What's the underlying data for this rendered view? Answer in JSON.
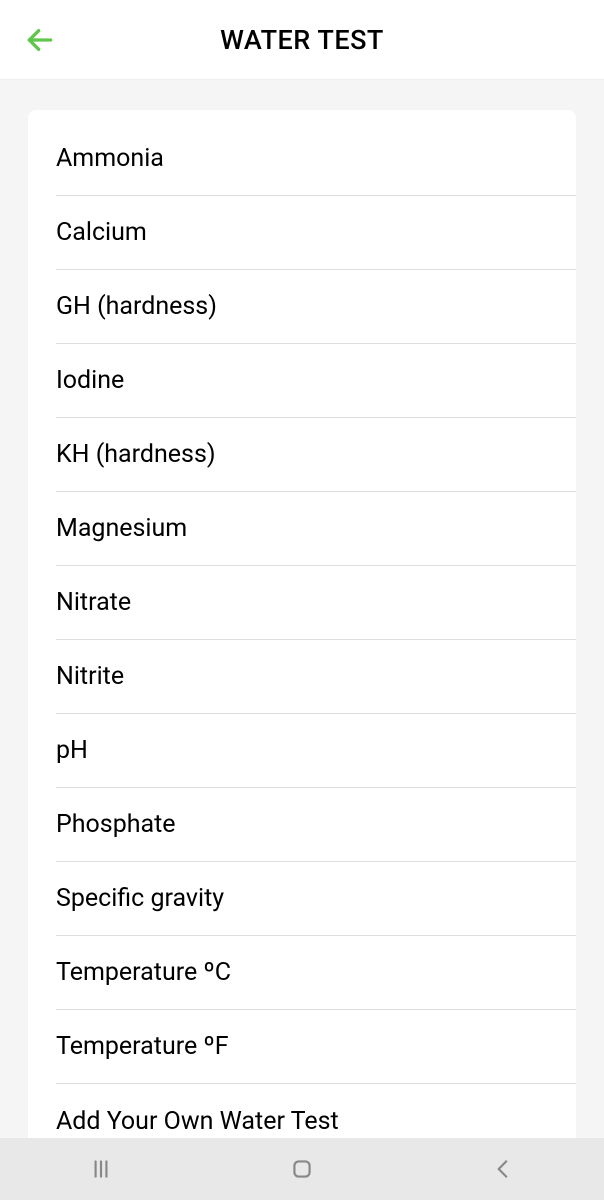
{
  "header": {
    "title": "WATER TEST"
  },
  "list": {
    "items": [
      {
        "label": "Ammonia"
      },
      {
        "label": "Calcium"
      },
      {
        "label": "GH (hardness)"
      },
      {
        "label": "Iodine"
      },
      {
        "label": "KH (hardness)"
      },
      {
        "label": "Magnesium"
      },
      {
        "label": "Nitrate"
      },
      {
        "label": "Nitrite"
      },
      {
        "label": "pH"
      },
      {
        "label": "Phosphate"
      },
      {
        "label": "Specific gravity"
      },
      {
        "label": "Temperature ºC"
      },
      {
        "label": "Temperature ºF"
      },
      {
        "label": "Add Your Own Water Test"
      }
    ]
  },
  "colors": {
    "accent": "#5fc54b"
  }
}
